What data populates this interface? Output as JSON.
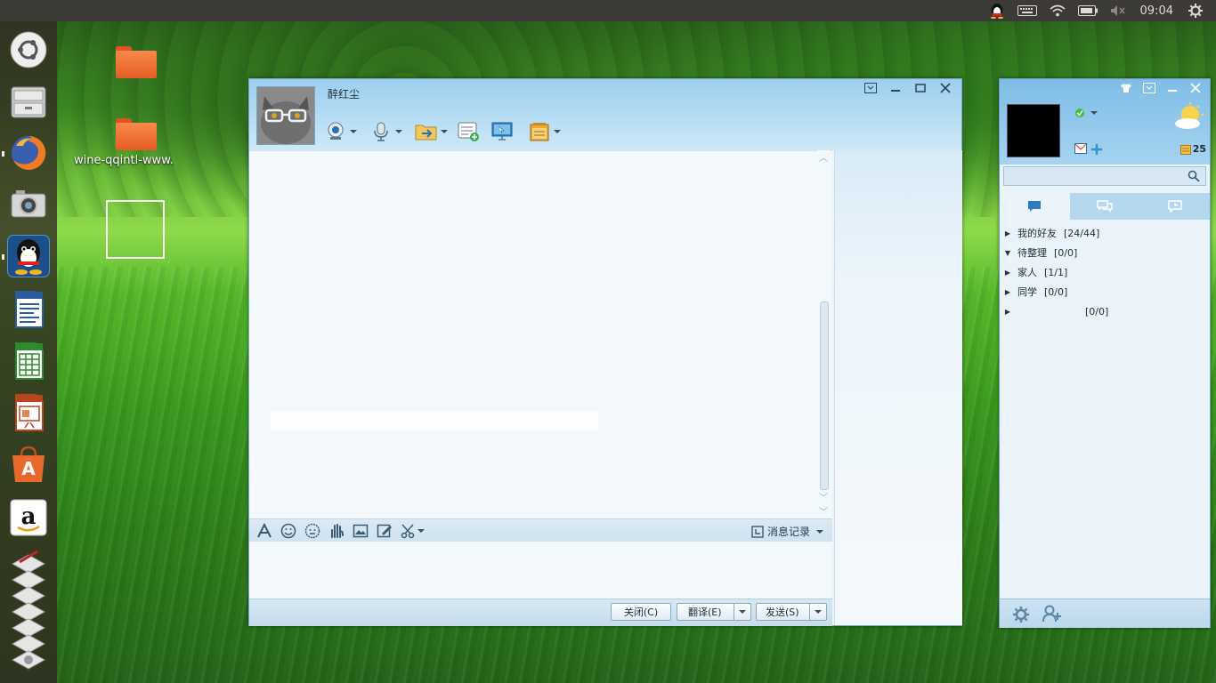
{
  "panel": {
    "indicators": [
      "qq-tray-icon",
      "keyboard-icon",
      "wifi-icon",
      "battery-icon",
      "volume-muted-icon"
    ],
    "clock": "09:04"
  },
  "launcher": {
    "items": [
      "ubuntu-dash-icon",
      "files-icon",
      "firefox-icon",
      "camera-icon",
      "qq-icon",
      "writer-icon",
      "calc-icon",
      "impress-icon",
      "software-center-icon",
      "amazon-icon",
      "wine-stack-icon"
    ]
  },
  "desktop": {
    "icons": [
      {
        "label": ""
      },
      {
        "label": "wine-qqintl-www."
      }
    ]
  },
  "chat": {
    "contact_name": "醉红尘",
    "toolbar": [
      "video-call-icon",
      "voice-call-icon",
      "send-file-icon",
      "create-group-icon",
      "remote-assist-icon",
      "app-box-icon"
    ],
    "format_icons": [
      "font-icon",
      "emoji-icon",
      "magic-emoji-icon",
      "nudge-icon",
      "image-icon",
      "doodle-icon",
      "screenshot-icon"
    ],
    "history_label": "消息记录",
    "buttons": {
      "close": "关闭(C)",
      "translate": "翻译(E)",
      "send": "发送(S)"
    }
  },
  "qq": {
    "weather_temp": "25",
    "search_placeholder": "",
    "groups": [
      {
        "name": "我的好友",
        "count": "[24/44]",
        "expanded": false
      },
      {
        "name": "待整理",
        "count": "[0/0]",
        "expanded": true
      },
      {
        "name": "家人",
        "count": "[1/1]",
        "expanded": false
      },
      {
        "name": "同学",
        "count": "[0/0]",
        "expanded": false
      },
      {
        "name": "",
        "count": "[0/0]",
        "expanded": false
      }
    ]
  }
}
